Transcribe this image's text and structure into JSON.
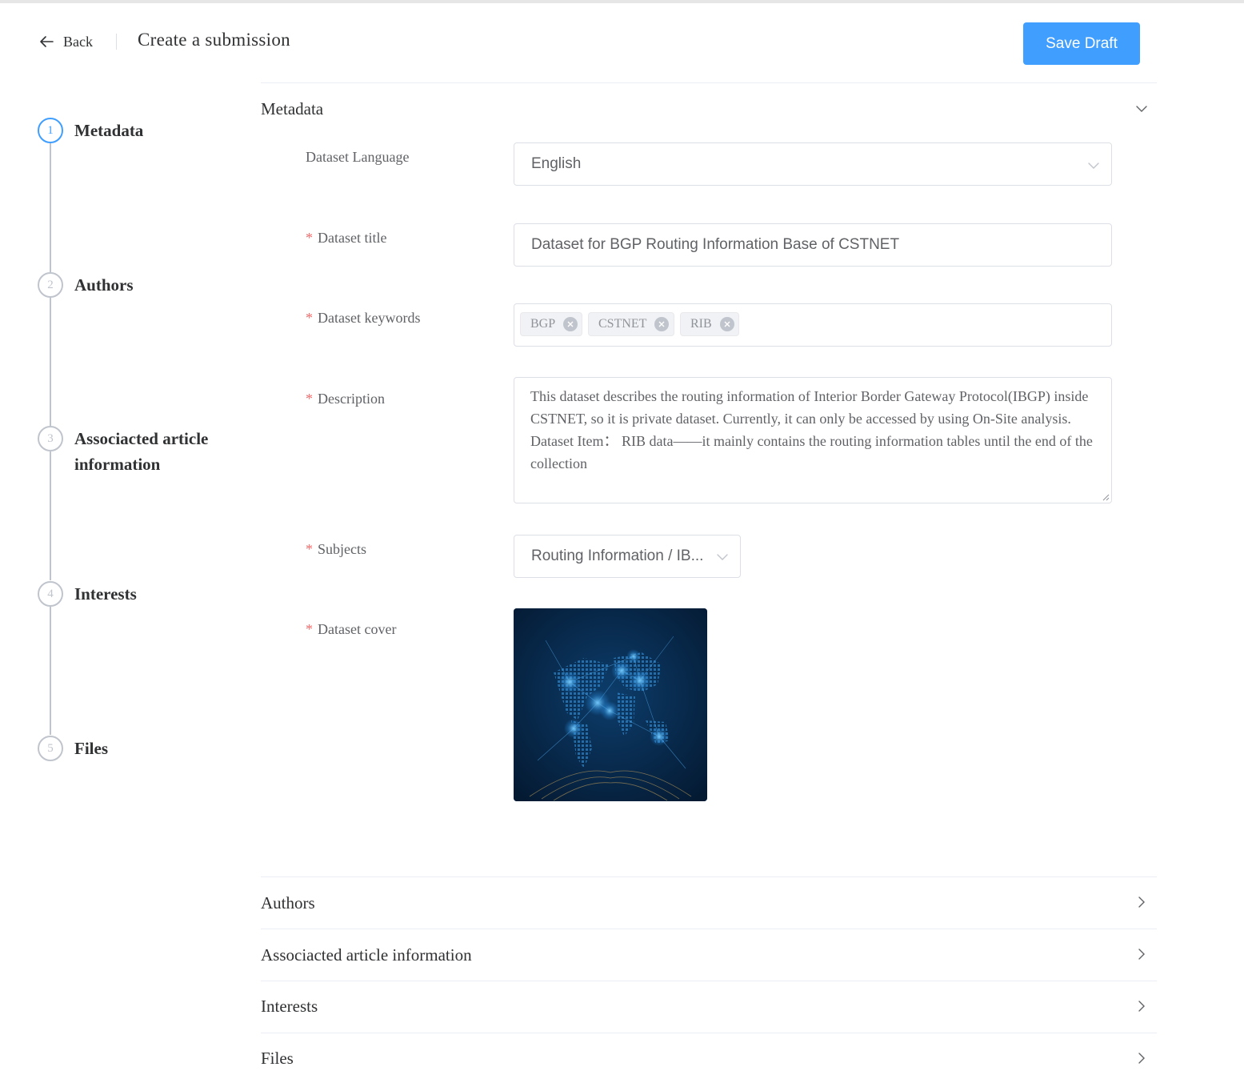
{
  "header": {
    "back_label": "Back",
    "title": "Create a submission",
    "save_label": "Save Draft"
  },
  "steps": [
    {
      "number": "1",
      "label": "Metadata",
      "active": true
    },
    {
      "number": "2",
      "label": "Authors",
      "active": false
    },
    {
      "number": "3",
      "label": "Associacted article information",
      "active": false
    },
    {
      "number": "4",
      "label": "Interests",
      "active": false
    },
    {
      "number": "5",
      "label": "Files",
      "active": false
    }
  ],
  "metadata": {
    "title": "Metadata",
    "language": {
      "label": "Dataset Language",
      "value": "English"
    },
    "dataset_title": {
      "label": "Dataset title",
      "value": "Dataset for BGP Routing Information Base of CSTNET"
    },
    "keywords": {
      "label": "Dataset keywords",
      "tags": [
        "BGP",
        "CSTNET",
        "RIB"
      ]
    },
    "description": {
      "label": "Description",
      "value": "This dataset describes the routing information of Interior Border Gateway Protocol(IBGP) inside CSTNET, so it is private dataset. Currently, it can only be accessed by using On-Site analysis. Dataset Item：  RIB data——it mainly contains the routing information tables until the end of the collection"
    },
    "subjects": {
      "label": "Subjects",
      "value": "Routing Information / IB..."
    },
    "cover": {
      "label": "Dataset cover"
    },
    "required_mark": "*"
  },
  "sections": [
    {
      "title": "Authors"
    },
    {
      "title": "Associacted article information"
    },
    {
      "title": "Interests"
    },
    {
      "title": "Files"
    }
  ],
  "colors": {
    "primary": "#409eff",
    "required": "#f56c6c",
    "border": "#dcdfe6"
  }
}
